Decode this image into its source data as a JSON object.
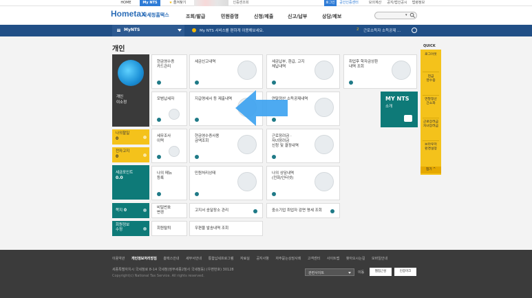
{
  "topbar": {
    "home": "HOME",
    "mynts": "My NTS",
    "favorite": "즐겨찾기",
    "cert": "인증센조회",
    "login": "로그인",
    "public_cert": "공인인증센터",
    "links": [
      "모의계산",
      "공지/법인공시",
      "법령정보"
    ]
  },
  "header": {
    "logo_main": "Hometax",
    "logo_sub": "국세청홈택스",
    "gnb": [
      "조회/발급",
      "민원증명",
      "신청/제출",
      "신고/납부",
      "상담/제보"
    ],
    "search_placeholder": ""
  },
  "navbar": {
    "menu_label": "MyNTS",
    "notice": "My NTS 서비스를 편하게 이용해보세요.",
    "notice_num": "2",
    "notice2": "근로소득자 소득공제 ..."
  },
  "page_title": "개인",
  "left": {
    "profile_label_1": "개인",
    "profile_label_2": "이소정",
    "cards": [
      {
        "label": "나의할일",
        "value": "0"
      },
      {
        "label": "전자고지",
        "value": "0"
      },
      {
        "label": "세금포인트",
        "value": "0.0"
      },
      {
        "label": "쪽지",
        "value": "0"
      },
      {
        "label": "회원정보",
        "value": "수정"
      }
    ]
  },
  "tiles": [
    {
      "label": "현금영수증\n카드관리",
      "icon": "card-icon"
    },
    {
      "label": "세금신고내역",
      "icon": "fax-icon"
    },
    {
      "label": "세금납부, 환급, 고지\n체납내역",
      "icon": "won-coin-icon"
    },
    {
      "label": "취업후 학자금상환\n내역 조회",
      "icon": "book-icon"
    },
    {
      "label": "모범납세자",
      "icon": "medal-icon"
    },
    {
      "label": "지급명세서 등 제출내역",
      "icon": "document-icon"
    },
    {
      "label": "연말정산 소득공제내역",
      "icon": "ledger-icon"
    },
    {
      "label": "세무조사\n이력",
      "icon": "notebook-icon"
    },
    {
      "label": "현금영수증사용\n금액조회",
      "icon": "receipt-icon"
    },
    {
      "label": "근로장려금 ·\n자녀장려금\n신청 및 결정내역",
      "icon": "open-book-icon"
    },
    {
      "label": "나의 메뉴\n등록",
      "icon": "list-icon"
    },
    {
      "label": "민원처리상태",
      "icon": "check-icon"
    },
    {
      "label": "나의 상담내역\n(전화/인터넷)",
      "icon": "headset-icon"
    }
  ],
  "small_tiles": [
    {
      "label": "비밀번호\n변경"
    },
    {
      "label": "고지서 송달장소 관리"
    },
    {
      "label": "중소기업 취업자 감면 명세 조회"
    },
    {
      "label": "회원탈퇴"
    },
    {
      "label": "우편물 발송내역 조회"
    }
  ],
  "mynts_box": {
    "title": "MY NTS",
    "sub": "소개"
  },
  "quick": {
    "header": "QUICK",
    "items": [
      "로그아웃",
      "현금\n영수증",
      "연말정산\n간소화",
      "근로장려금\n자녀장려금",
      "브라우저\n환경설정"
    ],
    "close": "접기"
  },
  "footer": {
    "links": [
      "이용약관",
      "개인정보처리방침",
      "홈택스안내",
      "세무서안내",
      "통합납세프로그램",
      "자료실",
      "공지사항",
      "자주묻는상담사례",
      "고객센터",
      "사이트맵",
      "찾아오시는길",
      "모바일안내"
    ],
    "address": "세종특별자치시 국세청로 8-14 국세청(정부세종2청사 국세청동) (우편번호) 30128",
    "copyright": "Copyright(c) National Tax Service. All rights reserved.",
    "related": "관련사이트",
    "move": "이동",
    "badge1": "웹접근성",
    "badge2": "인증마크"
  }
}
